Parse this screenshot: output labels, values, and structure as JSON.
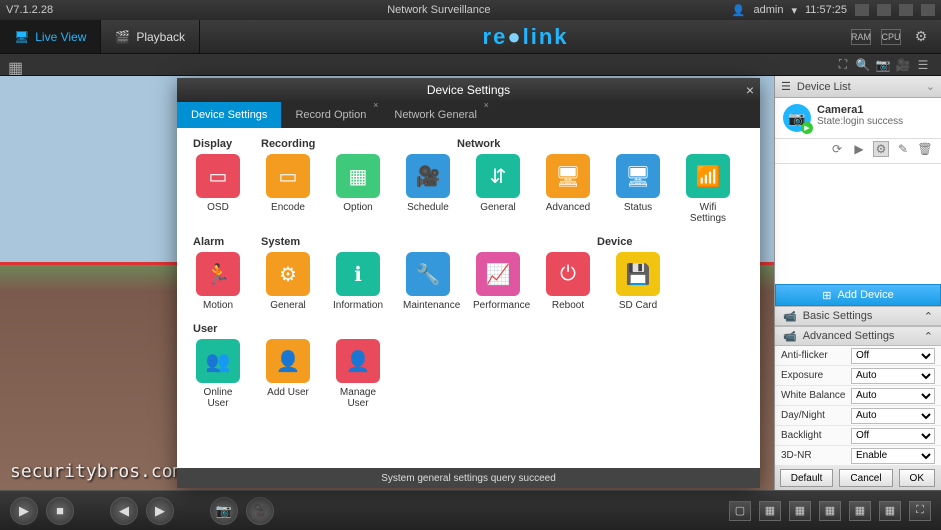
{
  "titlebar": {
    "version": "V7.1.2.28",
    "title": "Network Surveillance",
    "user": "admin",
    "time": "11:57:25"
  },
  "toolbar": {
    "liveview": "Live View",
    "playback": "Playback",
    "logo1": "re",
    "logo2": "link",
    "ram": "RAM",
    "cpu": "CPU"
  },
  "modal": {
    "title": "Device Settings",
    "tabs": {
      "t0": "Device Settings",
      "t1": "Record Option",
      "t2": "Network General"
    },
    "sections": {
      "display": "Display",
      "recording": "Recording",
      "network": "Network",
      "alarm": "Alarm",
      "system": "System",
      "device": "Device",
      "user": "User"
    },
    "tiles": {
      "osd": "OSD",
      "encode": "Encode",
      "option": "Option",
      "schedule": "Schedule",
      "general": "General",
      "advanced": "Advanced",
      "status": "Status",
      "wifi": "Wifi Settings",
      "motion": "Motion",
      "sysgeneral": "General",
      "information": "Information",
      "maintenance": "Maintenance",
      "performance": "Performance",
      "reboot": "Reboot",
      "sdcard": "SD Card",
      "onlineuser": "Online User",
      "adduser": "Add User",
      "manageuser": "Manage User"
    },
    "status": "System general settings query succeed"
  },
  "rightpanel": {
    "devicelist": "Device List",
    "camera": {
      "name": "Camera1",
      "state": "State:login success"
    },
    "adddevice": "Add Device",
    "basic": "Basic Settings",
    "advanced": "Advanced Settings",
    "settings": {
      "antiflicker": {
        "label": "Anti-flicker",
        "value": "Off"
      },
      "exposure": {
        "label": "Exposure",
        "value": "Auto"
      },
      "whitebalance": {
        "label": "White Balance",
        "value": "Auto"
      },
      "daynight": {
        "label": "Day/Night",
        "value": "Auto"
      },
      "backlight": {
        "label": "Backlight",
        "value": "Off"
      },
      "nr3d": {
        "label": "3D-NR",
        "value": "Enable"
      }
    },
    "footer": {
      "default": "Default",
      "cancel": "Cancel",
      "ok": "OK"
    }
  },
  "watermark": "securitybros.com"
}
